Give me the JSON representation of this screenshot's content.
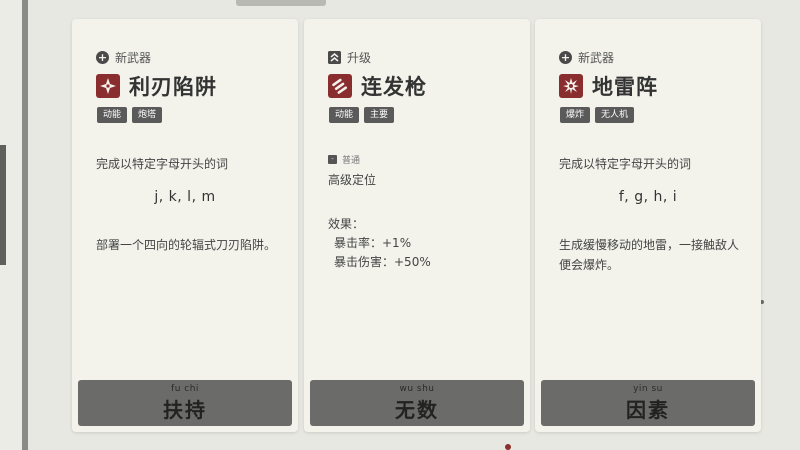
{
  "cards": [
    {
      "type_label": "新武器",
      "type_icon": "plus-circle-icon",
      "title": "利刃陷阱",
      "icon": "shuriken-icon",
      "tags": [
        "动能",
        "炮塔"
      ],
      "requirement": "完成以特定字母开头的词",
      "letters": "j, k, l, m",
      "description": "部署一个四向的轮辐式刀刃陷阱。",
      "pinyin": "fu chi",
      "hanzi": "扶持"
    },
    {
      "type_label": "升级",
      "type_icon": "double-chevron-up-icon",
      "title": "连发枪",
      "icon": "bullets-icon",
      "tags": [
        "动能",
        "主要"
      ],
      "rarity": "普通",
      "upgrade_name": "高级定位",
      "effects_label": "效果：",
      "effects": [
        "暴击率：+1%",
        "暴击伤害：+50%"
      ],
      "pinyin": "wu shu",
      "hanzi": "无数"
    },
    {
      "type_label": "新武器",
      "type_icon": "plus-circle-icon",
      "title": "地雷阵",
      "icon": "explosion-icon",
      "tags": [
        "爆炸",
        "无人机"
      ],
      "requirement": "完成以特定字母开头的词",
      "letters": "f, g, h, i",
      "description": "生成缓慢移动的地雷，一接触敌人便会爆炸。",
      "pinyin": "yin su",
      "hanzi": "因素"
    }
  ],
  "colors": {
    "card_bg": "#f3f3ec",
    "weapon_icon_bg": "#8a2d2e",
    "button_bg": "#6b6b6a",
    "tag_bg": "#5a5a5a"
  }
}
